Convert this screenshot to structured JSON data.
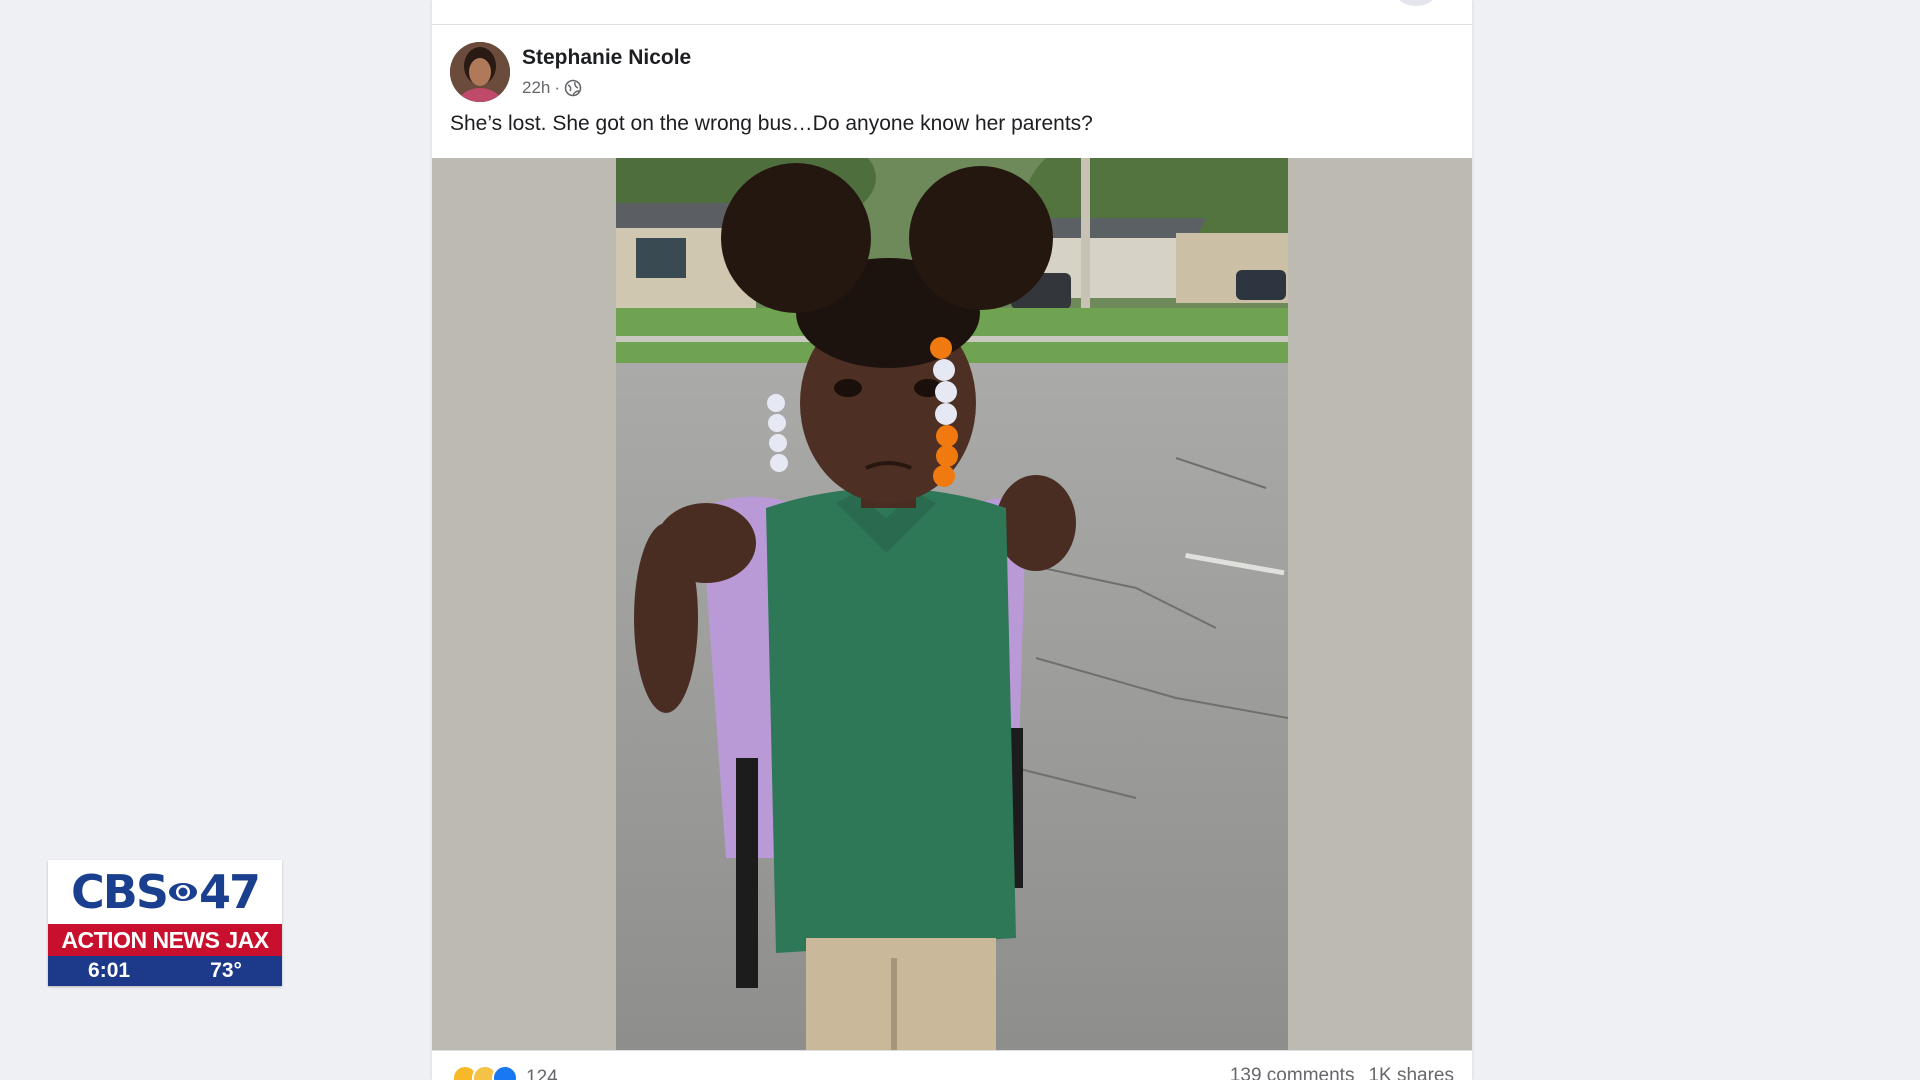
{
  "post": {
    "author": "Stephanie Nicole",
    "time": "22h",
    "separator": "·",
    "text": "She’s lost. She got on the wrong bus…Do anyone know her parents?",
    "photo_subject": "",
    "reaction_count": "124",
    "comments": "139 comments",
    "shares": "1K shares"
  },
  "icons": {
    "avatar": "avatar",
    "privacy": "globe-icon",
    "reactions": [
      "haha-icon",
      "care-icon",
      "like-icon"
    ]
  },
  "overlay": {
    "brand_left": "CBS",
    "brand_right": "47",
    "station": "ACTION NEWS JAX",
    "clock": "6:01",
    "temperature": "73°"
  },
  "colors": {
    "facebook_blue": "#1877f2",
    "cbs_blue": "#1a3f8f",
    "cbs_red": "#c8102e",
    "media_background": "#bdbab2"
  }
}
